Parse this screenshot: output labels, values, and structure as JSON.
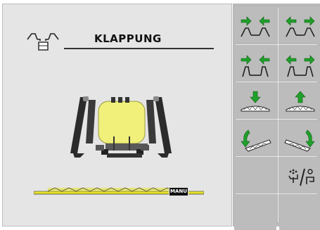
{
  "screen": {
    "title": "KLAPPUNG",
    "mode_badge": "MANU"
  },
  "softkeys": [
    {
      "id": "fold-out-left-arrows",
      "icon": "boom-fold-out-icon"
    },
    {
      "id": "fold-in-left-arrows",
      "icon": "boom-fold-in-icon"
    },
    {
      "id": "fold-out-right-arrows",
      "icon": "boom-fold-out-lower-icon"
    },
    {
      "id": "fold-in-right-arrows",
      "icon": "boom-fold-in-lower-icon"
    },
    {
      "id": "lower-boom",
      "icon": "boom-lower-icon"
    },
    {
      "id": "raise-boom",
      "icon": "boom-raise-icon"
    },
    {
      "id": "tilt-left",
      "icon": "boom-tilt-left-icon"
    },
    {
      "id": "tilt-right",
      "icon": "boom-tilt-right-icon"
    },
    {
      "id": "empty-left",
      "icon": ""
    },
    {
      "id": "auto-manual-toggle",
      "icon": "auto-manual-icon"
    },
    {
      "id": "empty-left-bottom",
      "icon": ""
    },
    {
      "id": "empty-right-bottom",
      "icon": ""
    }
  ],
  "colors": {
    "panel_bg": "#e5e5e5",
    "softkey_bg": "#bcbcbc",
    "arrow_green": "#1fa12a",
    "tank_yellow": "#f0f07a",
    "boom_yellow": "#e6e22a"
  }
}
